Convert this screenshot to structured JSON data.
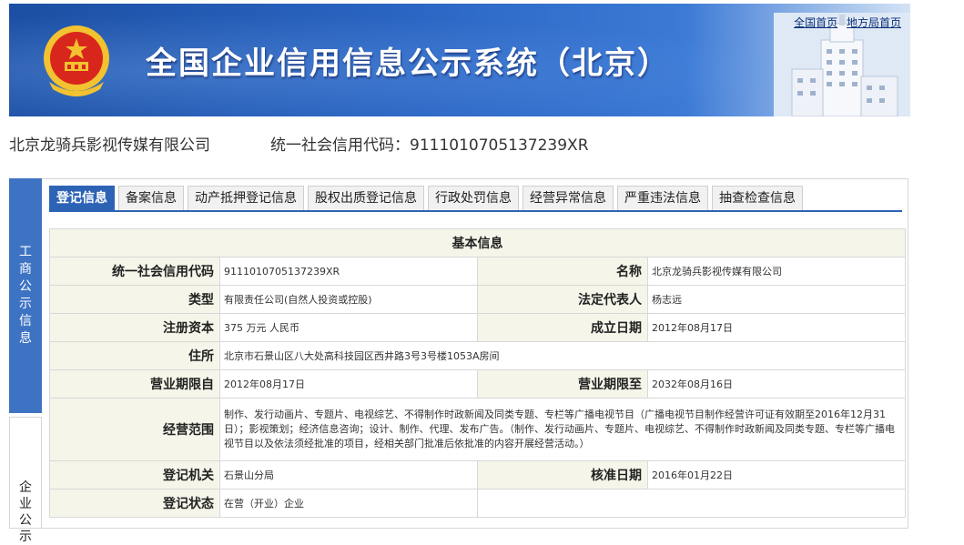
{
  "header": {
    "title": "全国企业信用信息公示系统（北京）",
    "links": [
      "全国首页",
      "地方局首页"
    ],
    "colors": {
      "banner_dark": "#1c4fa3",
      "banner_light": "#d4e3f5",
      "emblem_red": "#d9261c",
      "emblem_gold": "#f2c230"
    }
  },
  "company": {
    "name": "北京龙骑兵影视传媒有限公司",
    "code_line": "统一社会信用代码：9111010705137239XR"
  },
  "side_tabs": [
    {
      "label": "工商公示信息",
      "active": true
    },
    {
      "label": "企业公示",
      "active": false
    }
  ],
  "tabs": [
    "登记信息",
    "备案信息",
    "动产抵押登记信息",
    "股权出质登记信息",
    "行政处罚信息",
    "经营异常信息",
    "严重违法信息",
    "抽查检查信息"
  ],
  "active_tab": 0,
  "accent_color": "#2d63b5",
  "section_title": "基本信息",
  "fields": {
    "credit_code_label": "统一社会信用代码",
    "credit_code": "9111010705137239XR",
    "name_label": "名称",
    "name": "北京龙骑兵影视传媒有限公司",
    "type_label": "类型",
    "type": "有限责任公司(自然人投资或控股)",
    "legal_rep_label": "法定代表人",
    "legal_rep": "杨志远",
    "capital_label": "注册资本",
    "capital": "375 万元 人民币",
    "established_label": "成立日期",
    "established": "2012年08月17日",
    "address_label": "住所",
    "address": "北京市石景山区八大处高科技园区西井路3号3号楼1053A房间",
    "term_from_label": "营业期限自",
    "term_from": "2012年08月17日",
    "term_to_label": "营业期限至",
    "term_to": "2032年08月16日",
    "scope_label": "经营范围",
    "scope": "制作、发行动画片、专题片、电视综艺、不得制作时政新闻及同类专题、专栏等广播电视节目（广播电视节目制作经营许可证有效期至2016年12月31日）；影视策划；经济信息咨询；设计、制作、代理、发布广告。（制作、发行动画片、专题片、电视综艺、不得制作时政新闻及同类专题、专栏等广播电视节目以及依法须经批准的项目，经相关部门批准后依批准的内容开展经营活动。）",
    "authority_label": "登记机关",
    "authority": "石景山分局",
    "approval_label": "核准日期",
    "approval": "2016年01月22日",
    "status_label": "登记状态",
    "status": "在营（开业）企业"
  }
}
